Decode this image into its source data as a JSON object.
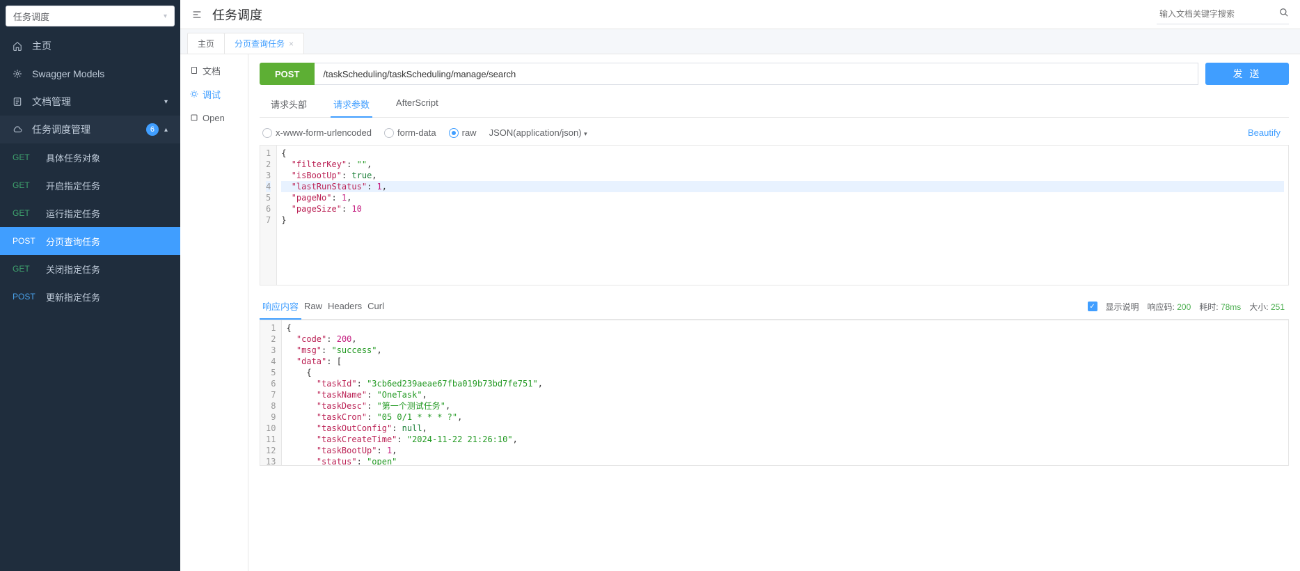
{
  "sidebar": {
    "select_label": "任务调度",
    "home_label": "主页",
    "swagger_models_label": "Swagger Models",
    "doc_manage_label": "文档管理",
    "group_label": "任务调度管理",
    "group_badge": "6",
    "endpoints": [
      {
        "method": "GET",
        "label": "具体任务对象",
        "active": false
      },
      {
        "method": "GET",
        "label": "开启指定任务",
        "active": false
      },
      {
        "method": "GET",
        "label": "运行指定任务",
        "active": false
      },
      {
        "method": "POST",
        "label": "分页查询任务",
        "active": true
      },
      {
        "method": "GET",
        "label": "关闭指定任务",
        "active": false
      },
      {
        "method": "POST",
        "label": "更新指定任务",
        "active": false
      }
    ]
  },
  "header": {
    "title": "任务调度",
    "search_placeholder": "输入文档关键字搜索"
  },
  "pagetabs": [
    {
      "label": "主页",
      "active": false,
      "closable": false
    },
    {
      "label": "分页查询任务",
      "active": true,
      "closable": true
    }
  ],
  "left_tabs": {
    "doc": "文档",
    "debug": "调试",
    "open": "Open"
  },
  "request": {
    "method": "POST",
    "url": "/taskScheduling/taskScheduling/manage/search",
    "send_label": "发 送"
  },
  "subtabs": {
    "header": "请求头部",
    "params": "请求参数",
    "after": "AfterScript"
  },
  "bodytype": {
    "xform": "x-www-form-urlencoded",
    "formdata": "form-data",
    "raw": "raw",
    "rawtype": "JSON(application/json)",
    "beautify": "Beautify"
  },
  "req_body_lines": [
    {
      "t": "punc",
      "text": "{"
    },
    {
      "t": "kv",
      "k": "filterKey",
      "v": "\"\"",
      "vt": "str",
      "comma": true
    },
    {
      "t": "kv",
      "k": "isBootUp",
      "v": "true",
      "vt": "kw",
      "comma": true
    },
    {
      "t": "kv",
      "k": "lastRunStatus",
      "v": "1",
      "vt": "num",
      "comma": true,
      "hl": true
    },
    {
      "t": "kv",
      "k": "pageNo",
      "v": "1",
      "vt": "num",
      "comma": true
    },
    {
      "t": "kv",
      "k": "pageSize",
      "v": "10",
      "vt": "num",
      "comma": false
    },
    {
      "t": "punc",
      "text": "}"
    }
  ],
  "resp_tabs": {
    "content": "响应内容",
    "raw": "Raw",
    "headers": "Headers",
    "curl": "Curl"
  },
  "resp_meta": {
    "show_desc_label": "显示说明",
    "code_label": "响应码:",
    "code": "200",
    "time_label": "耗时:",
    "time": "78ms",
    "size_label": "大小:",
    "size": "251"
  },
  "resp_body_lines": [
    "{",
    "  \"code\": 200,",
    "  \"msg\": \"success\",",
    "  \"data\": [",
    "    {",
    "      \"taskId\": \"3cb6ed239aeae67fba019b73bd7fe751\",",
    "      \"taskName\": \"OneTask\",",
    "      \"taskDesc\": \"第一个测试任务\",",
    "      \"taskCron\": \"05 0/1 * * * ?\",",
    "      \"taskOutConfig\": null,",
    "      \"taskCreateTime\": \"2024-11-22 21:26:10\",",
    "      \"taskBootUp\": 1,",
    "      \"status\": \"open\"",
    "    }",
    "  ]",
    "}"
  ]
}
